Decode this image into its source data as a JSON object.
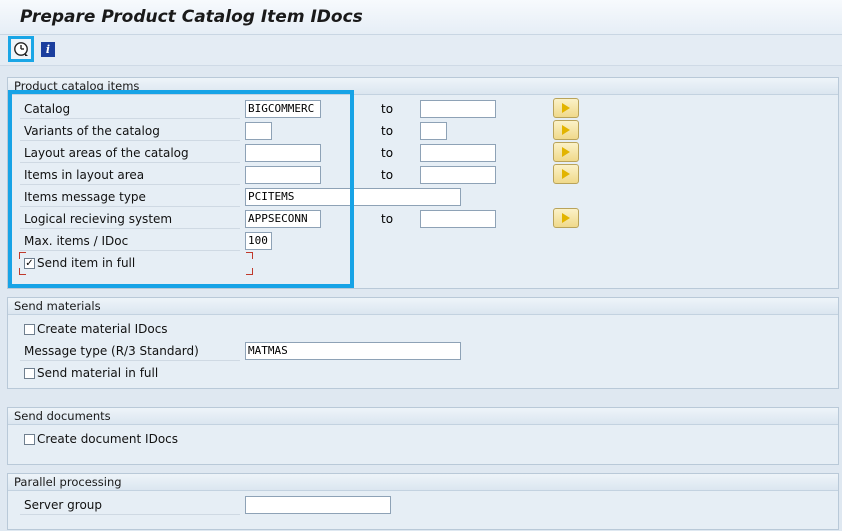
{
  "title": "Prepare Product Catalog Item IDocs",
  "toolbar": {
    "execute_icon": "clock-execute-icon",
    "info_icon": "info-icon",
    "info_glyph": "i"
  },
  "catalog_items": {
    "header": "Product catalog items",
    "to_label": "to",
    "rows": {
      "catalog": {
        "label": "Catalog",
        "from": "BIGCOMMERC",
        "to": ""
      },
      "variants": {
        "label": "Variants of the catalog",
        "from": "",
        "to": ""
      },
      "layout_areas": {
        "label": "Layout areas of the catalog",
        "from": "",
        "to": ""
      },
      "items_layout": {
        "label": "Items in layout area",
        "from": "",
        "to": ""
      },
      "msg_type": {
        "label": "Items message type",
        "value": "PCITEMS"
      },
      "logical_sys": {
        "label": "Logical recieving system",
        "from": "APPSECONN",
        "to": ""
      },
      "max_items": {
        "label": "Max. items / IDoc",
        "value": "100"
      },
      "send_full": {
        "label": "Send item in full",
        "checked": "✓"
      }
    }
  },
  "send_materials": {
    "header": "Send materials",
    "create_idocs": {
      "label": "Create material IDocs",
      "checked": ""
    },
    "msg_type": {
      "label": "Message type (R/3 Standard)",
      "value": "MATMAS"
    },
    "send_full": {
      "label": "Send material in full",
      "checked": ""
    }
  },
  "send_documents": {
    "header": "Send documents",
    "create_idocs": {
      "label": "Create document IDocs",
      "checked": ""
    }
  },
  "parallel": {
    "header": "Parallel processing",
    "server_group": {
      "label": "Server group",
      "value": ""
    }
  },
  "colors": {
    "highlight": "#17a3e6",
    "background": "#dfe8f1"
  }
}
